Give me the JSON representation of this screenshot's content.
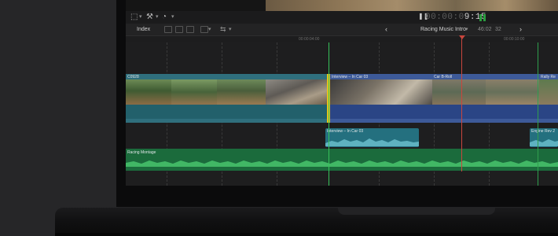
{
  "viewer": {
    "timecode_dim": "00:00:0",
    "timecode_bright": "9:15",
    "pause_icon": "pause-icon"
  },
  "toolbar": {
    "index_label": "Index",
    "project_name": "Racing Music Intro",
    "duration": "46:02",
    "zoom": "32"
  },
  "ruler": {
    "marks": [
      "00:00:04:00",
      "00:00:10:00"
    ]
  },
  "clips": {
    "primary": [
      {
        "label": "C0928"
      },
      {
        "label": "Interview – In Car 03"
      },
      {
        "label": "Car B-Roll"
      },
      {
        "label": "Rally Re"
      }
    ],
    "connected": [
      {
        "label": "Interview – In Car 03"
      },
      {
        "label": "Engine Rev 2"
      }
    ],
    "music": {
      "label": "Racing Montage"
    }
  },
  "colors": {
    "video_teal": "#2f6f7d",
    "video_blue": "#3d5a99",
    "audio_teal": "#24707f",
    "music_green": "#1b6b3c",
    "playhead": "#c9463d",
    "skimmer": "#37c35a",
    "edit_point": "#e2c21d"
  }
}
